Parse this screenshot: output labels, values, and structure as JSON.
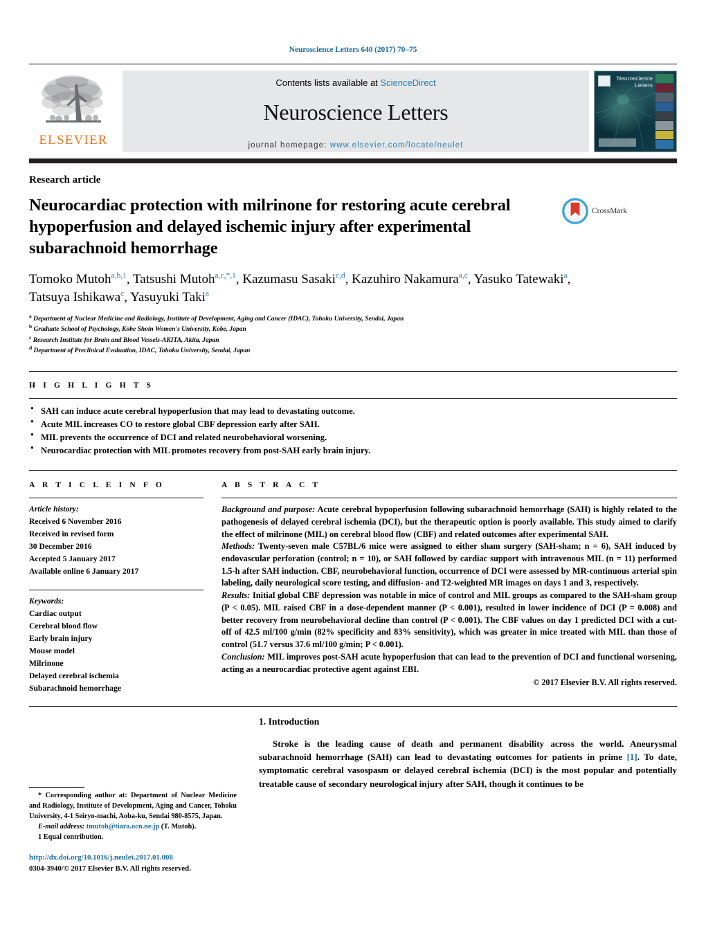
{
  "running_head": "Neuroscience Letters 640 (2017) 70–75",
  "masthead": {
    "contents_prefix": "Contents lists available at ",
    "sciencedirect": "ScienceDirect",
    "journal_name": "Neuroscience Letters",
    "homepage_label": "journal homepage: ",
    "homepage_url": "www.elsevier.com/locate/neulet",
    "publisher_wordmark": "ELSEVIER",
    "cover_title": "Neuroscience Letters",
    "brand_color": "#E87722",
    "link_color": "#2a7db3"
  },
  "article": {
    "type": "Research article",
    "title": "Neurocardiac protection with milrinone for restoring acute cerebral hypoperfusion and delayed ischemic injury after experimental subarachnoid hemorrhage",
    "crossmark_label": "CrossMark",
    "authors": [
      {
        "name": "Tomoko Mutoh",
        "marks": "a,b,1",
        "sep": ", "
      },
      {
        "name": "Tatsushi Mutoh",
        "marks": "a,c,*,1",
        "sep": ", "
      },
      {
        "name": "Kazumasu Sasaki",
        "marks": "c,d",
        "sep": ", "
      },
      {
        "name": "Kazuhiro Nakamura",
        "marks": "a,c",
        "sep": ", "
      },
      {
        "name": "Yasuko Tatewaki",
        "marks": "a",
        "sep": ", "
      },
      {
        "name": "Tatsuya Ishikawa",
        "marks": "c",
        "sep": ", "
      },
      {
        "name": "Yasuyuki Taki",
        "marks": "a",
        "sep": ""
      }
    ],
    "affiliations": [
      {
        "mark": "a",
        "text": "Department of Nuclear Medicine and Radiology, Institute of Development, Aging and Cancer (IDAC), Tohoku University, Sendai, Japan"
      },
      {
        "mark": "b",
        "text": "Graduate School of Psychology, Kobe Shoin Women's University, Kobe, Japan"
      },
      {
        "mark": "c",
        "text": "Research Institute for Brain and Blood Vessels-AKITA, Akita, Japan"
      },
      {
        "mark": "d",
        "text": "Department of Preclinical Evaluation, IDAC, Tohoku University, Sendai, Japan"
      }
    ]
  },
  "highlights": {
    "heading": "H I G H L I G H T S",
    "items": [
      "SAH can induce acute cerebral hypoperfusion that may lead to devastating outcome.",
      "Acute MIL increases CO to restore global CBF depression early after SAH.",
      "MIL prevents the occurrence of DCI and related neurobehavioral worsening.",
      "Neurocardiac protection with MIL promotes recovery from post-SAH early brain injury."
    ]
  },
  "article_info": {
    "heading": "A R T I C L E   I N F O",
    "history_label": "Article history:",
    "history": [
      "Received 6 November 2016",
      "Received in revised form",
      "30 December 2016",
      "Accepted 5 January 2017",
      "Available online 6 January 2017"
    ],
    "keywords_label": "Keywords:",
    "keywords": [
      "Cardiac output",
      "Cerebral blood flow",
      "Early brain injury",
      "Mouse model",
      "Milrinone",
      "Delayed cerebral ischemia",
      "Subarachnoid hemorrhage"
    ]
  },
  "abstract": {
    "heading": "A B S T R A C T",
    "sections": [
      {
        "lead": "Background and purpose:",
        "text": " Acute cerebral hypoperfusion following subarachnoid hemorrhage (SAH) is highly related to the pathogenesis of delayed cerebral ischemia (DCI), but the therapeutic option is poorly available. This study aimed to clarify the effect of milrinone (MIL) on cerebral blood flow (CBF) and related outcomes after experimental SAH."
      },
      {
        "lead": "Methods:",
        "text": " Twenty-seven male C57BL/6 mice were assigned to either sham surgery (SAH-sham; n = 6), SAH induced by endovascular perforation (control; n = 10), or SAH followed by cardiac support with intravenous MIL (n = 11) performed 1.5-h after SAH induction. CBF, neurobehavioral function, occurrence of DCI were assessed by MR-continuous arterial spin labeling, daily neurological score testing, and diffusion- and T2-weighted MR images on days 1 and 3, respectively."
      },
      {
        "lead": "Results:",
        "text": " Initial global CBF depression was notable in mice of control and MIL groups as compared to the SAH-sham group (P < 0.05). MIL raised CBF in a dose-dependent manner (P < 0.001), resulted in lower incidence of DCI (P = 0.008) and better recovery from neurobehavioral decline than control (P < 0.001). The CBF values on day 1 predicted DCI with a cut-off of 42.5 ml/100 g/min (82% specificity and 83% sensitivity), which was greater in mice treated with MIL than those of control (51.7 versus 37.6 ml/100 g/min; P < 0.001)."
      },
      {
        "lead": "Conclusion:",
        "text": " MIL improves post-SAH acute hypoperfusion that can lead to the prevention of DCI and functional worsening, acting as a neurocardiac protective agent against EBI."
      }
    ],
    "copyright": "© 2017 Elsevier B.V. All rights reserved."
  },
  "footnotes": {
    "corresponding": "* Corresponding author at: Department of Nuclear Medicine and Radiology, Institute of Development, Aging and Cancer, Tohoku University, 4-1 Seiryo-machi, Aoba-ku, Sendai 980-8575, Japan.",
    "email_label": "E-mail address:",
    "email": "tmutoh@tiara.ocn.ne.jp",
    "email_suffix": " (T. Mutoh).",
    "equal_contribution": "1  Equal contribution.",
    "doi": "http://dx.doi.org/10.1016/j.neulet.2017.01.008",
    "issn_line": "0304-3940/© 2017 Elsevier B.V. All rights reserved."
  },
  "introduction": {
    "heading": "1. Introduction",
    "paragraph_1": "Stroke is the leading cause of death and permanent disability across the world. Aneurysmal subarachnoid hemorrhage (SAH) can lead to devastating outcomes for patients in prime ",
    "citation_1": "[1]",
    "paragraph_1b": ". To date, symptomatic cerebral vasospasm or delayed cerebral ischemia (DCI) is the most popular and potentially treatable cause of secondary neurological injury after SAH, though it continues to be"
  }
}
